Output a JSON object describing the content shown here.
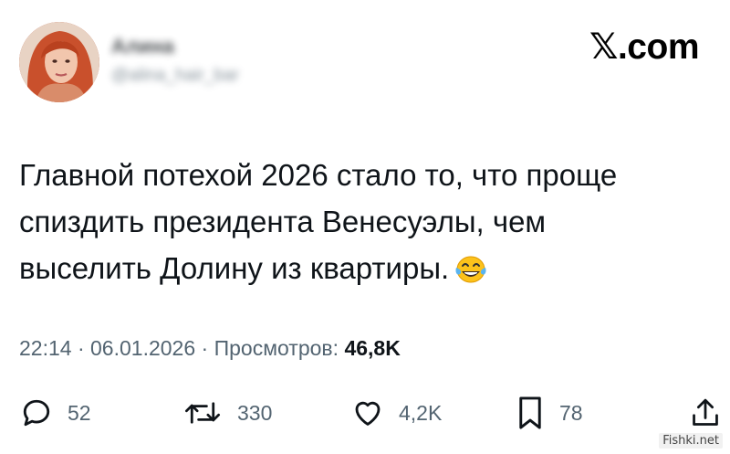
{
  "author": {
    "name": "Алина",
    "handle": "@alina_hair_bar"
  },
  "brand": "𝕏.com",
  "tweet": {
    "lines": [
      "Главной потехой 2026 стало то, что проще",
      "спиздить президента Венесуэлы, чем",
      "выселить Долину из квартиры."
    ],
    "emoji": "tears-of-joy-emoji"
  },
  "meta": {
    "time": "22:14",
    "date": "06.01.2026",
    "views_label": "Просмотров:",
    "views_count": "46,8K",
    "sep": " · "
  },
  "actions": {
    "replies": "52",
    "reposts": "330",
    "likes": "4,2K",
    "bookmarks": "78"
  },
  "watermark": "Fishki.net",
  "colors": {
    "text": "#0f1419",
    "secondary": "#536471",
    "background": "#ffffff"
  }
}
